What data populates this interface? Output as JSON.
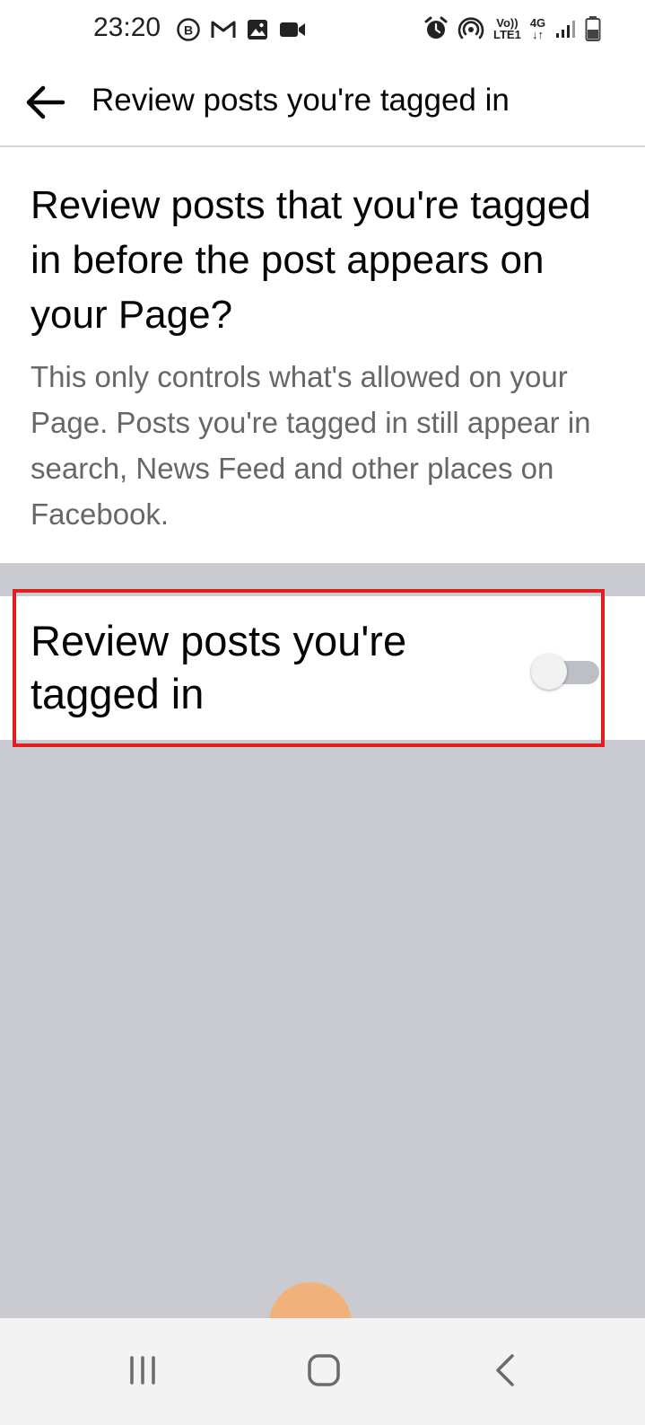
{
  "status_bar": {
    "time": "23:20",
    "left_icons": [
      "b-circle-icon",
      "gmail-icon",
      "gallery-icon",
      "video-icon"
    ],
    "right_icons": [
      "alarm-icon",
      "hotspot-icon",
      "volte-icon",
      "4g-icon",
      "signal-icon",
      "battery-icon"
    ],
    "volte_line1": "Vo))",
    "volte_line2": "LTE1",
    "net_type": "4G"
  },
  "app_bar": {
    "back_icon": "arrow-left-icon",
    "title": "Review posts you're tagged in"
  },
  "intro": {
    "heading": "Review posts that you're tagged in before the post appears on your Page?",
    "description": "This only controls what's allowed on your Page. Posts you're tagged in still appear in search, News Feed and other places on Facebook."
  },
  "setting": {
    "label": "Review posts you're tagged in",
    "enabled": false,
    "highlight_color": "#e02020"
  },
  "nav_bar": {
    "recent_icon": "recent-apps-icon",
    "home_icon": "home-icon",
    "back_icon": "back-chevron-icon"
  },
  "colors": {
    "page_background": "#c9cbd1",
    "secondary_text": "#65676b",
    "toggle_off_track": "#bcc0c4"
  }
}
